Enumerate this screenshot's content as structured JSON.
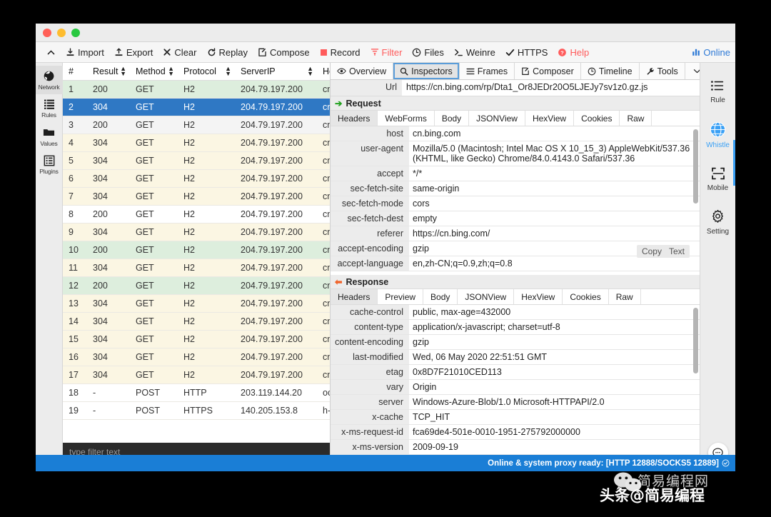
{
  "window": {
    "traffic_lights": [
      "close",
      "minimize",
      "zoom"
    ]
  },
  "toolbar": {
    "collapse_label": "",
    "items": [
      {
        "id": "import",
        "label": "Import",
        "icon": "import-icon",
        "color": "#222222"
      },
      {
        "id": "export",
        "label": "Export",
        "icon": "export-icon",
        "color": "#222222"
      },
      {
        "id": "clear",
        "label": "Clear",
        "icon": "close-x-icon",
        "color": "#222222"
      },
      {
        "id": "replay",
        "label": "Replay",
        "icon": "refresh-icon",
        "color": "#222222"
      },
      {
        "id": "compose",
        "label": "Compose",
        "icon": "edit-icon",
        "color": "#222222"
      },
      {
        "id": "record",
        "label": "Record",
        "icon": "record-square-icon",
        "color": "#222222"
      },
      {
        "id": "filter",
        "label": "Filter",
        "icon": "funnel-icon",
        "color": "#ff5b5b"
      },
      {
        "id": "files",
        "label": "Files",
        "icon": "clock-files-icon",
        "color": "#222222"
      },
      {
        "id": "weinre",
        "label": "Weinre",
        "icon": "terminal-icon",
        "color": "#222222"
      },
      {
        "id": "https",
        "label": "HTTPS",
        "icon": "check-icon",
        "color": "#222222"
      },
      {
        "id": "help",
        "label": "Help",
        "icon": "question-circle-icon",
        "color": "#ff5b5b"
      }
    ],
    "online": {
      "label": "Online",
      "icon": "bar-chart-icon",
      "color": "#2d79d6"
    }
  },
  "left_rail": {
    "items": [
      {
        "id": "network",
        "label": "Network",
        "icon": "globe-icon",
        "active": true
      },
      {
        "id": "rules",
        "label": "Rules",
        "icon": "list-icon",
        "active": false
      },
      {
        "id": "values",
        "label": "Values",
        "icon": "folder-icon",
        "active": false
      },
      {
        "id": "plugins",
        "label": "Plugins",
        "icon": "plugin-icon",
        "active": false
      }
    ]
  },
  "right_rail": {
    "items": [
      {
        "id": "rule",
        "label": "Rule",
        "icon": "bullet-list-icon",
        "active": false
      },
      {
        "id": "whistle",
        "label": "Whistle",
        "icon": "globe-grid-icon",
        "active": true
      },
      {
        "id": "mobile",
        "label": "Mobile",
        "icon": "scan-frame-icon",
        "active": false
      },
      {
        "id": "setting",
        "label": "Setting",
        "icon": "gear-icon",
        "active": false
      }
    ],
    "fab": {
      "id": "chat",
      "icon": "chat-bubble-icon"
    },
    "accent": "#3aa0f5"
  },
  "network_table": {
    "columns": [
      "#",
      "Result",
      "Method",
      "Protocol",
      "ServerIP",
      "Ho"
    ],
    "sortable": [
      false,
      true,
      true,
      true,
      true,
      true
    ],
    "rows": [
      {
        "n": "1",
        "result": "200",
        "method": "GET",
        "protocol": "H2",
        "serverip": "204.79.197.200",
        "host": "cn",
        "style": "r-200"
      },
      {
        "n": "2",
        "result": "304",
        "method": "GET",
        "protocol": "H2",
        "serverip": "204.79.197.200",
        "host": "cn",
        "style": "r-sel"
      },
      {
        "n": "3",
        "result": "200",
        "method": "GET",
        "protocol": "H2",
        "serverip": "204.79.197.200",
        "host": "cn",
        "style": "r-gray"
      },
      {
        "n": "4",
        "result": "304",
        "method": "GET",
        "protocol": "H2",
        "serverip": "204.79.197.200",
        "host": "cn",
        "style": "r-304"
      },
      {
        "n": "5",
        "result": "304",
        "method": "GET",
        "protocol": "H2",
        "serverip": "204.79.197.200",
        "host": "cn",
        "style": "r-304"
      },
      {
        "n": "6",
        "result": "304",
        "method": "GET",
        "protocol": "H2",
        "serverip": "204.79.197.200",
        "host": "cn",
        "style": "r-304"
      },
      {
        "n": "7",
        "result": "304",
        "method": "GET",
        "protocol": "H2",
        "serverip": "204.79.197.200",
        "host": "cn",
        "style": "r-304"
      },
      {
        "n": "8",
        "result": "200",
        "method": "GET",
        "protocol": "H2",
        "serverip": "204.79.197.200",
        "host": "cn",
        "style": "r-white"
      },
      {
        "n": "9",
        "result": "304",
        "method": "GET",
        "protocol": "H2",
        "serverip": "204.79.197.200",
        "host": "cn",
        "style": "r-304"
      },
      {
        "n": "10",
        "result": "200",
        "method": "GET",
        "protocol": "H2",
        "serverip": "204.79.197.200",
        "host": "cn",
        "style": "r-200"
      },
      {
        "n": "11",
        "result": "304",
        "method": "GET",
        "protocol": "H2",
        "serverip": "204.79.197.200",
        "host": "cn",
        "style": "r-304"
      },
      {
        "n": "12",
        "result": "200",
        "method": "GET",
        "protocol": "H2",
        "serverip": "204.79.197.200",
        "host": "cn",
        "style": "r-200"
      },
      {
        "n": "13",
        "result": "304",
        "method": "GET",
        "protocol": "H2",
        "serverip": "204.79.197.200",
        "host": "cn",
        "style": "r-304"
      },
      {
        "n": "14",
        "result": "304",
        "method": "GET",
        "protocol": "H2",
        "serverip": "204.79.197.200",
        "host": "cn",
        "style": "r-304"
      },
      {
        "n": "15",
        "result": "304",
        "method": "GET",
        "protocol": "H2",
        "serverip": "204.79.197.200",
        "host": "cn",
        "style": "r-304"
      },
      {
        "n": "16",
        "result": "304",
        "method": "GET",
        "protocol": "H2",
        "serverip": "204.79.197.200",
        "host": "cn",
        "style": "r-304"
      },
      {
        "n": "17",
        "result": "304",
        "method": "GET",
        "protocol": "H2",
        "serverip": "204.79.197.200",
        "host": "cn",
        "style": "r-304"
      },
      {
        "n": "18",
        "result": "-",
        "method": "POST",
        "protocol": "HTTP",
        "serverip": "203.119.144.20",
        "host": "oc",
        "style": "r-white"
      },
      {
        "n": "19",
        "result": "-",
        "method": "POST",
        "protocol": "HTTPS",
        "serverip": "140.205.153.8",
        "host": "h-a",
        "style": "r-white"
      }
    ],
    "filter_placeholder": "type filter text"
  },
  "inspector": {
    "tabs": [
      {
        "id": "overview",
        "label": "Overview",
        "icon": "eye-icon",
        "selected": false
      },
      {
        "id": "inspectors",
        "label": "Inspectors",
        "icon": "search-icon",
        "selected": true
      },
      {
        "id": "frames",
        "label": "Frames",
        "icon": "lines-icon",
        "selected": false
      },
      {
        "id": "composer",
        "label": "Composer",
        "icon": "edit-icon",
        "selected": false
      },
      {
        "id": "timeline",
        "label": "Timeline",
        "icon": "clock-icon",
        "selected": false
      },
      {
        "id": "tools",
        "label": "Tools",
        "icon": "wrench-icon",
        "selected": false
      },
      {
        "id": "more",
        "label": "",
        "icon": "chevron-down-icon",
        "selected": false
      }
    ],
    "url_label": "Url",
    "url_value": "https://cn.bing.com/rp/Dta1_Or8JEDr20O5LJEJy7sv1z0.gz.js",
    "request": {
      "title": "Request",
      "arrow": "arrow-right-icon",
      "subtabs": [
        {
          "label": "Headers",
          "selected": true
        },
        {
          "label": "WebForms",
          "selected": false
        },
        {
          "label": "Body",
          "selected": false
        },
        {
          "label": "JSONView",
          "selected": false
        },
        {
          "label": "HexView",
          "selected": false
        },
        {
          "label": "Cookies",
          "selected": false
        },
        {
          "label": "Raw",
          "selected": false
        }
      ],
      "actions": [
        "Copy",
        "Text"
      ],
      "headers": [
        {
          "k": "host",
          "v": "cn.bing.com"
        },
        {
          "k": "user-agent",
          "v": "Mozilla/5.0 (Macintosh; Intel Mac OS X 10_15_3) AppleWebKit/537.36 (KHTML, like Gecko) Chrome/84.0.4143.0 Safari/537.36"
        },
        {
          "k": "accept",
          "v": "*/*"
        },
        {
          "k": "sec-fetch-site",
          "v": "same-origin"
        },
        {
          "k": "sec-fetch-mode",
          "v": "cors"
        },
        {
          "k": "sec-fetch-dest",
          "v": "empty"
        },
        {
          "k": "referer",
          "v": "https://cn.bing.com/"
        },
        {
          "k": "accept-encoding",
          "v": "gzip"
        },
        {
          "k": "accept-language",
          "v": "en,zh-CN;q=0.9,zh;q=0.8"
        }
      ]
    },
    "response": {
      "title": "Response",
      "arrow": "arrow-left-icon",
      "subtabs": [
        {
          "label": "Headers",
          "selected": true
        },
        {
          "label": "Preview",
          "selected": false
        },
        {
          "label": "Body",
          "selected": false
        },
        {
          "label": "JSONView",
          "selected": false
        },
        {
          "label": "HexView",
          "selected": false
        },
        {
          "label": "Cookies",
          "selected": false
        },
        {
          "label": "Raw",
          "selected": false
        }
      ],
      "headers": [
        {
          "k": "cache-control",
          "v": "public, max-age=432000"
        },
        {
          "k": "content-type",
          "v": "application/x-javascript; charset=utf-8"
        },
        {
          "k": "content-encoding",
          "v": "gzip"
        },
        {
          "k": "last-modified",
          "v": "Wed, 06 May 2020 22:51:51 GMT"
        },
        {
          "k": "etag",
          "v": "0x8D7F21010CED113"
        },
        {
          "k": "vary",
          "v": "Origin"
        },
        {
          "k": "server",
          "v": "Windows-Azure-Blob/1.0 Microsoft-HTTPAPI/2.0"
        },
        {
          "k": "x-cache",
          "v": "TCP_HIT"
        },
        {
          "k": "x-ms-request-id",
          "v": "fca69de4-501e-0010-1951-275792000000"
        },
        {
          "k": "x-ms-version",
          "v": "2009-09-19"
        }
      ]
    }
  },
  "statusbar": {
    "text": "Online & system proxy ready: [HTTP 12888/SOCKS5 12889]",
    "icon": "check-circle-icon",
    "bg": "#1a7ed6"
  },
  "watermark": {
    "site": "简易编程网",
    "toutiao": "头条@简易编程",
    "wechat_icon": "wechat-icon"
  }
}
